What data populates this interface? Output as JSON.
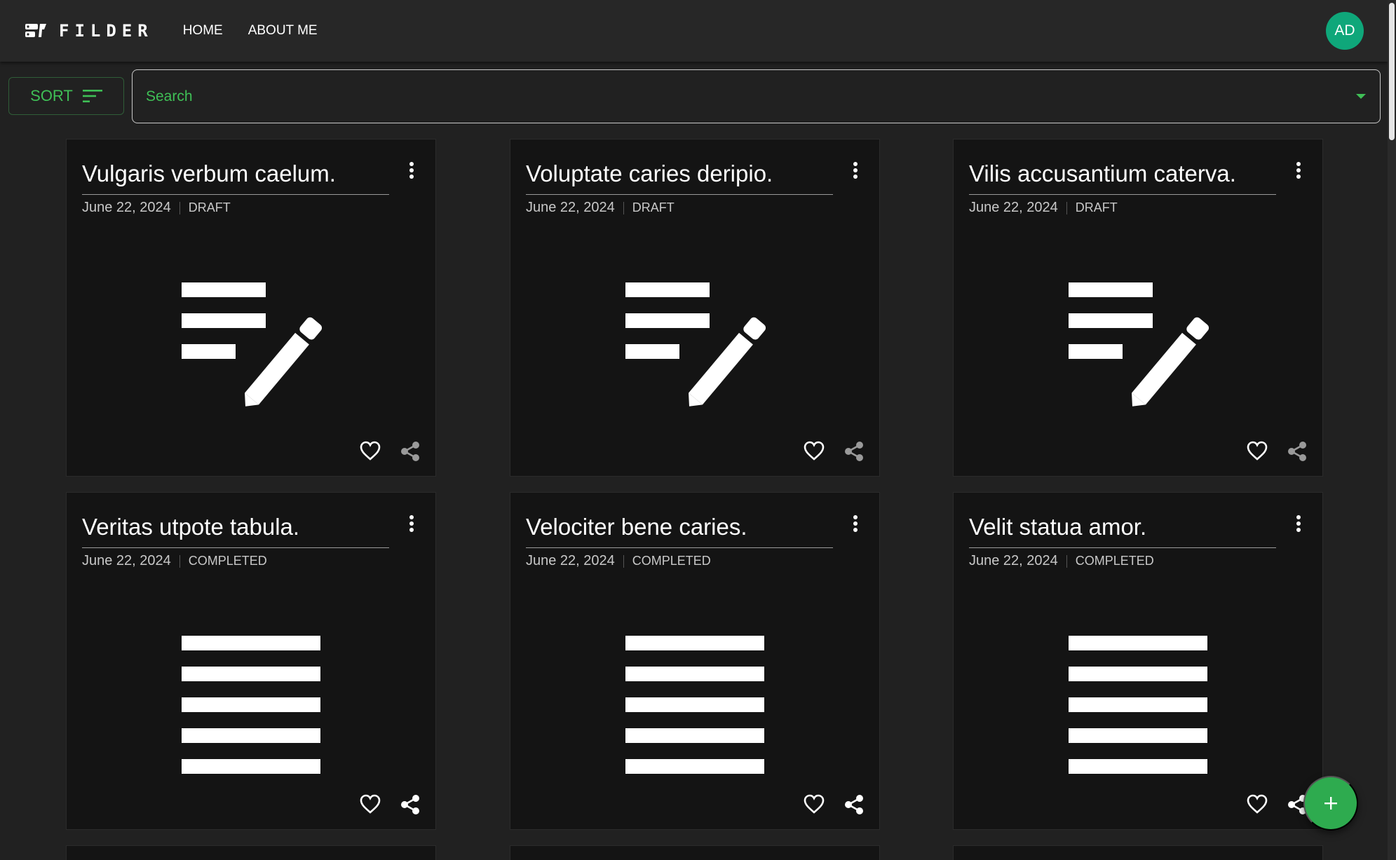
{
  "app": {
    "brand": "FILDER",
    "nav": [
      {
        "label": "HOME"
      },
      {
        "label": "ABOUT ME"
      }
    ],
    "user_initials": "AD"
  },
  "toolbar": {
    "sort_label": "SORT",
    "search_placeholder": "Search"
  },
  "colors": {
    "accent": "#3fbf56",
    "avatar": "#0fa77a",
    "fab": "#2eab4f",
    "card_bg": "#141414",
    "page_bg": "#212121"
  },
  "cards": [
    {
      "title": "Vulgaris verbum caelum.",
      "date": "June 22, 2024",
      "status": "DRAFT",
      "icon": "edit-note-icon"
    },
    {
      "title": "Voluptate caries deripio.",
      "date": "June 22, 2024",
      "status": "DRAFT",
      "icon": "edit-note-icon"
    },
    {
      "title": "Vilis accusantium caterva.",
      "date": "June 22, 2024",
      "status": "DRAFT",
      "icon": "edit-note-icon"
    },
    {
      "title": "Veritas utpote tabula.",
      "date": "June 22, 2024",
      "status": "COMPLETED",
      "icon": "text-lines-icon"
    },
    {
      "title": "Velociter bene caries.",
      "date": "June 22, 2024",
      "status": "COMPLETED",
      "icon": "text-lines-icon"
    },
    {
      "title": "Velit statua amor.",
      "date": "June 22, 2024",
      "status": "COMPLETED",
      "icon": "text-lines-icon"
    }
  ],
  "fab": {
    "icon": "plus-icon"
  }
}
